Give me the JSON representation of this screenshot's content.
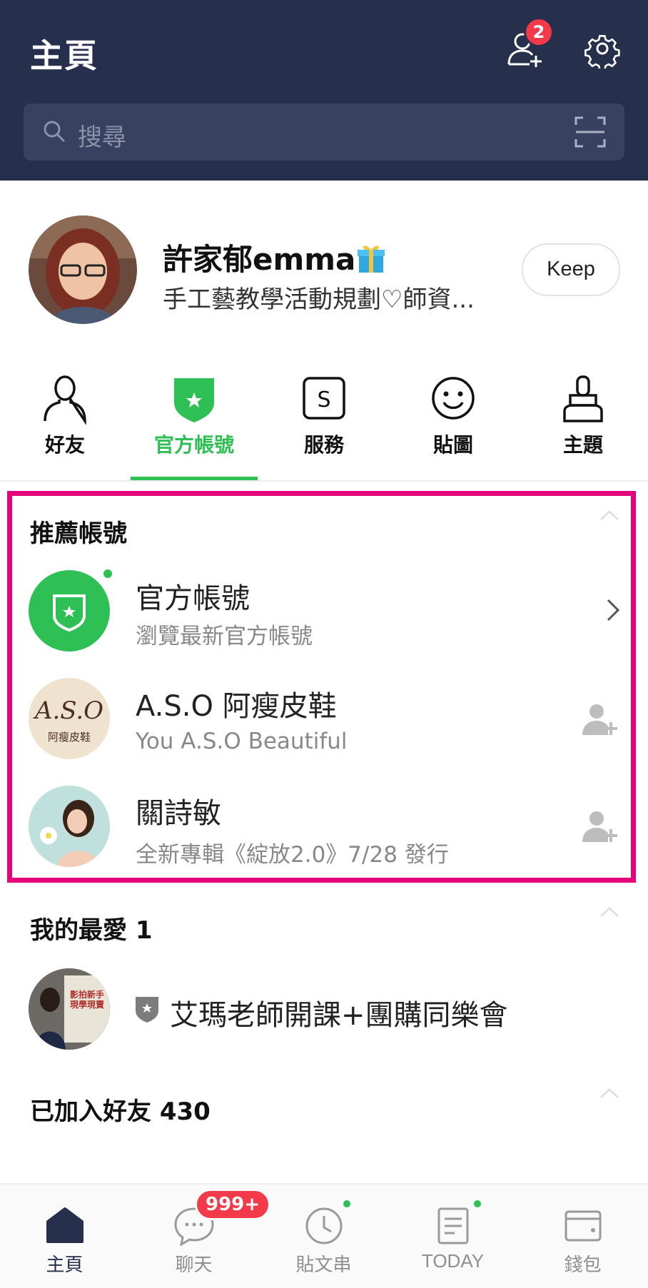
{
  "header": {
    "title": "主頁",
    "friend_requests_count": "2",
    "add_friend_icon": "add-friend-icon",
    "settings_icon": "gear-icon"
  },
  "search": {
    "placeholder": "搜尋",
    "scan_icon": "qr-scan-icon"
  },
  "profile": {
    "name": "許家郁emma",
    "name_emoji": "🎁",
    "status_message": "手工藝教學活動規劃♡師資...",
    "keep_label": "Keep"
  },
  "categories": [
    {
      "label": "好友",
      "icon": "person-icon",
      "active": false
    },
    {
      "label": "官方帳號",
      "icon": "shield-star-icon",
      "active": true
    },
    {
      "label": "服務",
      "icon": "service-s-icon",
      "active": false
    },
    {
      "label": "貼圖",
      "icon": "smile-icon",
      "active": false
    },
    {
      "label": "主題",
      "icon": "brush-icon",
      "active": false
    }
  ],
  "recommended": {
    "title": "推薦帳號",
    "items": [
      {
        "title": "官方帳號",
        "subtitle": "瀏覽最新官方帳號",
        "action": "chevron-right-icon"
      },
      {
        "title": "A.S.O 阿瘦皮鞋",
        "subtitle": "You A.S.O Beautiful",
        "logo_text": "A.S.O",
        "logo_sub": "阿瘦皮鞋",
        "action": "add-friend-icon"
      },
      {
        "title": "關詩敏",
        "subtitle": "全新專輯《綻放2.0》7/28 發行",
        "action": "add-friend-icon"
      }
    ]
  },
  "favorites": {
    "title": "我的最愛 1",
    "items": [
      {
        "name": "艾瑪老師開課+團購同樂會",
        "avatar_text": "影拍新手 現學現賣"
      }
    ]
  },
  "friends": {
    "title": "已加入好友 430"
  },
  "bottom_nav": [
    {
      "label": "主頁",
      "icon": "home-icon",
      "active": true
    },
    {
      "label": "聊天",
      "icon": "chat-icon",
      "badge": "999+"
    },
    {
      "label": "貼文串",
      "icon": "clock-icon",
      "dot": true
    },
    {
      "label": "TODAY",
      "icon": "news-icon",
      "dot": true
    },
    {
      "label": "錢包",
      "icon": "wallet-icon"
    }
  ],
  "colors": {
    "header_bg": "#26304d",
    "accent_green": "#2fc055",
    "badge_red": "#f23a4b",
    "highlight_pink": "#e5037a"
  }
}
